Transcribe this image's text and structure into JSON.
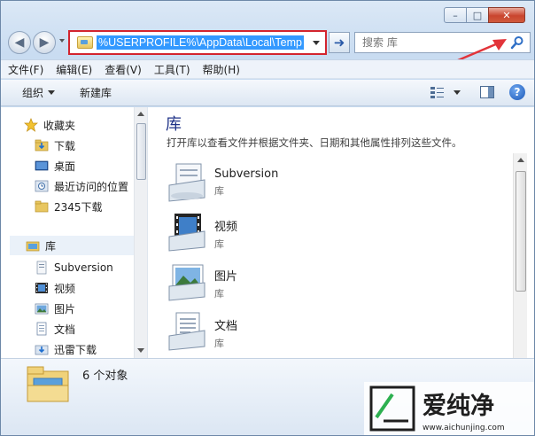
{
  "window": {
    "caption_buttons": [
      "minimize",
      "maximize",
      "close"
    ]
  },
  "address_bar": {
    "path": "%USERPROFILE%\\AppData\\Local\\Temp"
  },
  "search": {
    "placeholder": "搜索 库"
  },
  "menu": {
    "items": [
      "文件(F)",
      "编辑(E)",
      "查看(V)",
      "工具(T)",
      "帮助(H)"
    ]
  },
  "toolbar": {
    "organize_label": "组织",
    "new_library_label": "新建库"
  },
  "nav_pane": {
    "favorites": {
      "label": "收藏夹",
      "items": [
        "下载",
        "桌面",
        "最近访问的位置",
        "2345下载"
      ]
    },
    "libraries": {
      "label": "库",
      "items": [
        "Subversion",
        "视频",
        "图片",
        "文档",
        "迅雷下载"
      ]
    }
  },
  "content": {
    "title": "库",
    "description": "打开库以查看文件并根据文件夹、日期和其他属性排列这些文件。",
    "items": [
      {
        "name": "Subversion",
        "type": "库",
        "icon": "subversion-library-icon"
      },
      {
        "name": "视频",
        "type": "库",
        "icon": "video-library-icon"
      },
      {
        "name": "图片",
        "type": "库",
        "icon": "pictures-library-icon"
      },
      {
        "name": "文档",
        "type": "库",
        "icon": "documents-library-icon"
      }
    ]
  },
  "details": {
    "count_text": "6 个对象"
  },
  "watermark": {
    "text": "爱纯净",
    "url": "www.aichunjing.com"
  },
  "colors": {
    "address_highlight_border": "#d3242e",
    "selection": "#3399ff",
    "library_title": "#1e3287",
    "annotation_arrow": "#e2343a"
  }
}
